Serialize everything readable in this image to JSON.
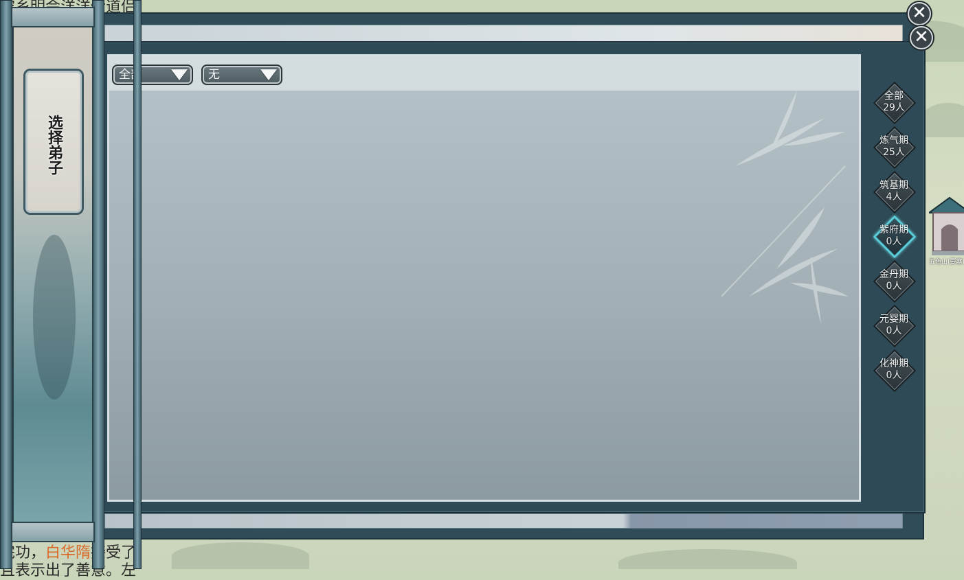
{
  "background": {
    "log_top": "空乡明会洋洋传道侣",
    "log_bottom_pre": "完功，",
    "log_bottom_highlight": "白华隋",
    "log_bottom_post": "接受了",
    "log_bottom_line2": "且表示出了善意。左",
    "building_label": "五色山(要塞)"
  },
  "left_panel": {
    "title": "选择弟子"
  },
  "filters": {
    "dropdown_1": "全部",
    "dropdown_2": "无"
  },
  "realm_tabs": [
    {
      "name": "全部",
      "count": "29人"
    },
    {
      "name": "炼气期",
      "count": "25人"
    },
    {
      "name": "筑基期",
      "count": "4人"
    },
    {
      "name": "紫府期",
      "count": "0人"
    },
    {
      "name": "金丹期",
      "count": "0人"
    },
    {
      "name": "元婴期",
      "count": "0人"
    },
    {
      "name": "化神期",
      "count": "0人"
    }
  ],
  "active_tab": "紫府期",
  "colors": {
    "accent": "#5fd5e0",
    "highlight_text": "#d86a2a",
    "frame": "#2d4a56"
  },
  "icons": {
    "close": "close-icon",
    "dropdown_arrow": "triangle-down-icon"
  }
}
